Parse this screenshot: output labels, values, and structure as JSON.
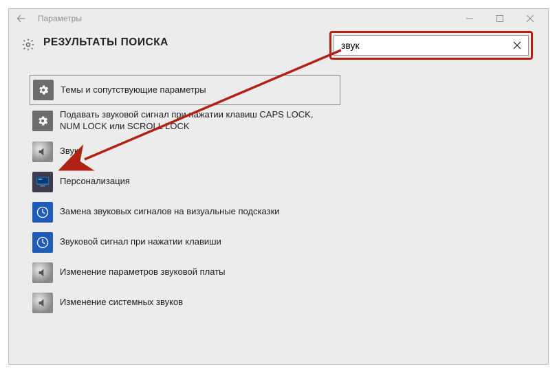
{
  "window": {
    "title": "Параметры"
  },
  "header": {
    "title": "РЕЗУЛЬТАТЫ ПОИСКА"
  },
  "search": {
    "value": "звук"
  },
  "results": [
    {
      "label": "Темы и сопутствующие параметры"
    },
    {
      "label": "Подавать звуковой сигнал при нажатии клавиш CAPS LOCK, NUM LOCK или SCROLL LOCK"
    },
    {
      "label": "Звук"
    },
    {
      "label": "Персонализация"
    },
    {
      "label": "Замена звуковых сигналов на визуальные подсказки"
    },
    {
      "label": "Звуковой сигнал при нажатии клавиши"
    },
    {
      "label": "Изменение параметров звуковой платы"
    },
    {
      "label": "Изменение системных звуков"
    }
  ]
}
